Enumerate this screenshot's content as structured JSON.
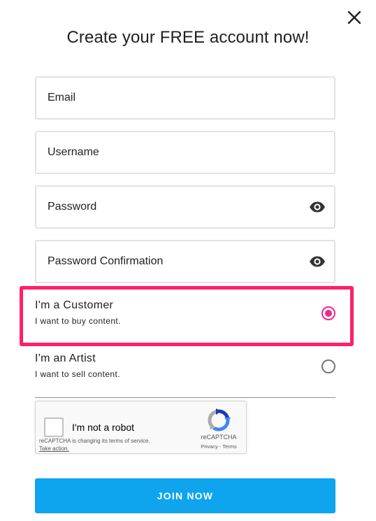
{
  "modal": {
    "title": "Create your FREE account now!"
  },
  "form": {
    "email_placeholder": "Email",
    "username_placeholder": "Username",
    "password_placeholder": "Password",
    "password_confirmation_placeholder": "Password Confirmation"
  },
  "roles": [
    {
      "title": "I'm a Customer",
      "subtitle": "I want to buy content.",
      "selected": true
    },
    {
      "title": "I'm an Artist",
      "subtitle": "I want to sell content.",
      "selected": false
    }
  ],
  "recaptcha": {
    "label": "I'm not a robot",
    "notice": "reCAPTCHA is changing its terms of service.",
    "notice_link": "Take action.",
    "brand": "reCAPTCHA",
    "privacy": "Privacy",
    "terms_separator": " - ",
    "terms": "Terms",
    "checked": false
  },
  "submit": {
    "label": "JOIN NOW"
  },
  "icons": {
    "close": "close-icon",
    "password_visibility": "eye-icon",
    "recaptcha_logo": "recaptcha-logo-icon"
  },
  "colors": {
    "accent_pink": "#ec2a8c",
    "highlight_border": "#ff1f6a",
    "button_blue": "#0ea4ee",
    "field_border": "#e2e2e2"
  }
}
